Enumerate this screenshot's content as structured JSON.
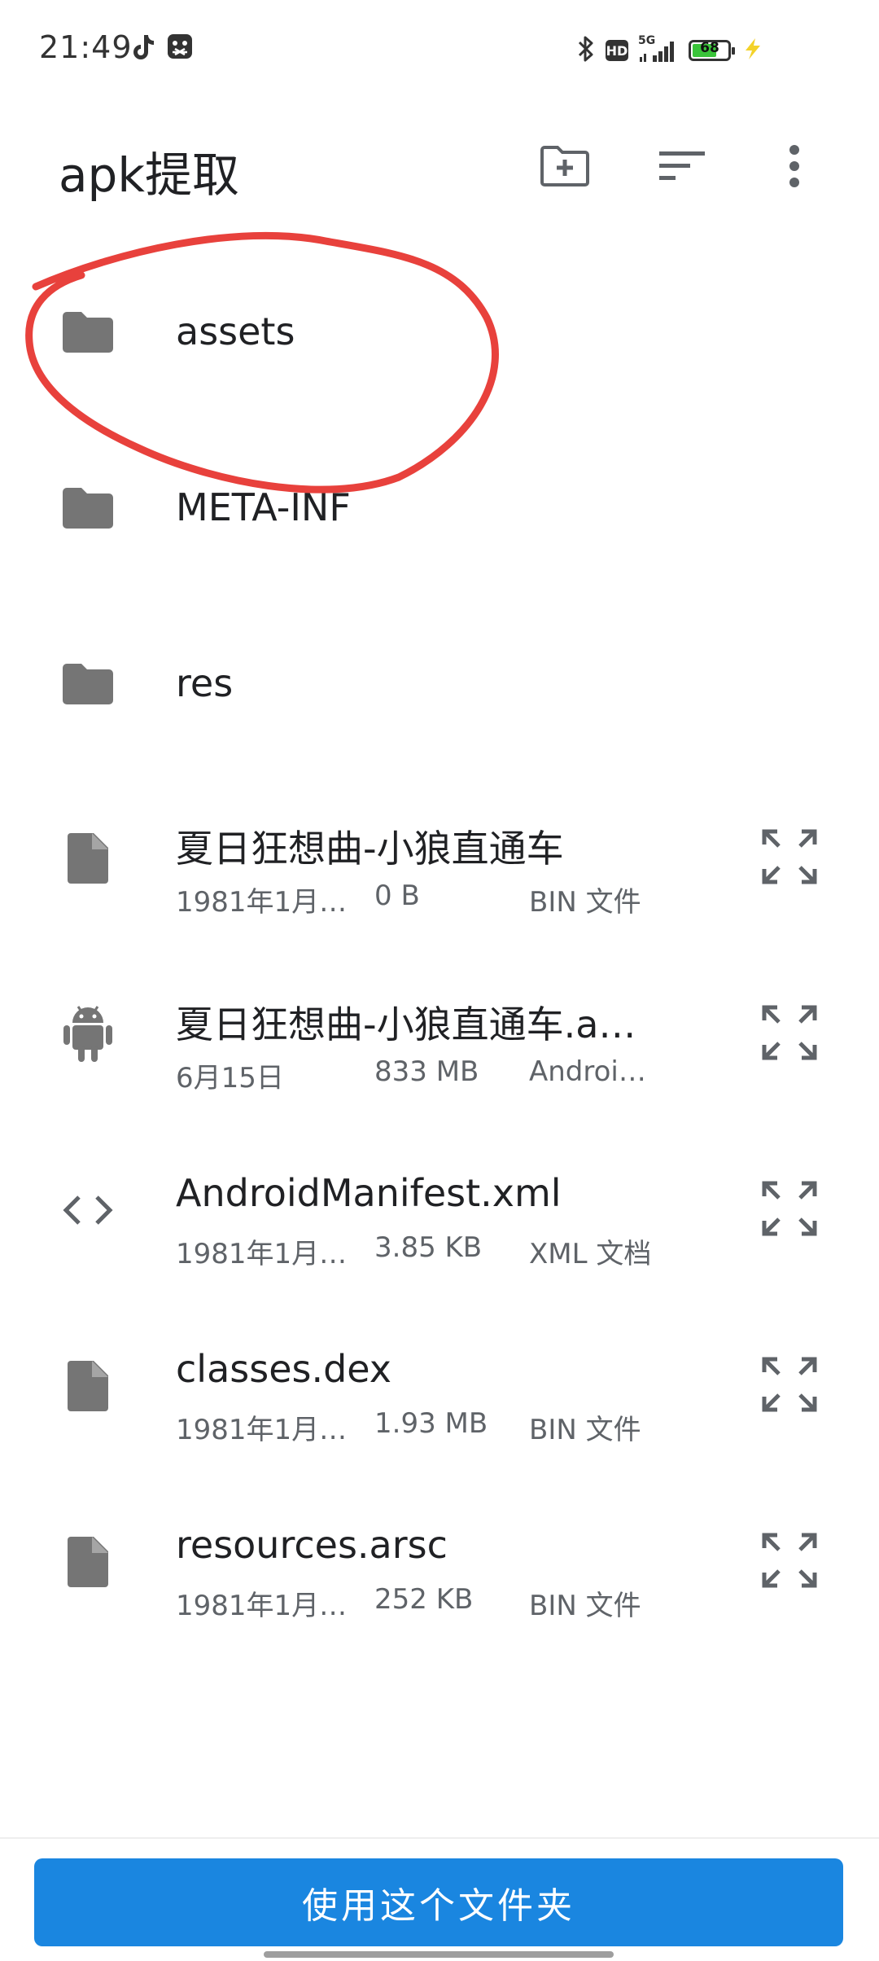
{
  "status_bar": {
    "time": "21:49",
    "network": "5G",
    "hd_label": "HD",
    "battery_level": "68",
    "battery_fraction": 0.68,
    "battery_color": "#3ac43a",
    "icons": [
      "tiktok-icon",
      "screenshot-app-icon",
      "bluetooth-icon",
      "hd-icon",
      "signal-icon",
      "battery-icon",
      "charging-icon"
    ]
  },
  "app_bar": {
    "title": "apk提取",
    "actions": [
      "new-folder-icon",
      "sort-icon",
      "more-vert-icon"
    ]
  },
  "files": [
    {
      "name": "assets",
      "kind": "folder",
      "icon": "folder-icon"
    },
    {
      "name": "META-INF",
      "kind": "folder",
      "icon": "folder-icon"
    },
    {
      "name": "res",
      "kind": "folder",
      "icon": "folder-icon"
    },
    {
      "name": "夏日狂想曲-小狼直通车",
      "kind": "file",
      "icon": "file-icon",
      "date": "1981年1月…",
      "size": "0 B",
      "type": "BIN 文件"
    },
    {
      "name": "夏日狂想曲-小狼直通车.a…",
      "kind": "file",
      "icon": "android-icon",
      "date": "6月15日",
      "size": "833 MB",
      "type": "Androi…"
    },
    {
      "name": "AndroidManifest.xml",
      "kind": "file",
      "icon": "code-icon",
      "date": "1981年1月…",
      "size": "3.85 KB",
      "type": "XML 文档"
    },
    {
      "name": "classes.dex",
      "kind": "file",
      "icon": "file-icon",
      "date": "1981年1月…",
      "size": "1.93 MB",
      "type": "BIN 文件"
    },
    {
      "name": "resources.arsc",
      "kind": "file",
      "icon": "file-icon",
      "date": "1981年1月…",
      "size": "252 KB",
      "type": "BIN 文件"
    }
  ],
  "bottom": {
    "use_folder_label": "使用这个文件夹",
    "button_color": "#1a86e0"
  },
  "annotation_color": "#e8413c"
}
